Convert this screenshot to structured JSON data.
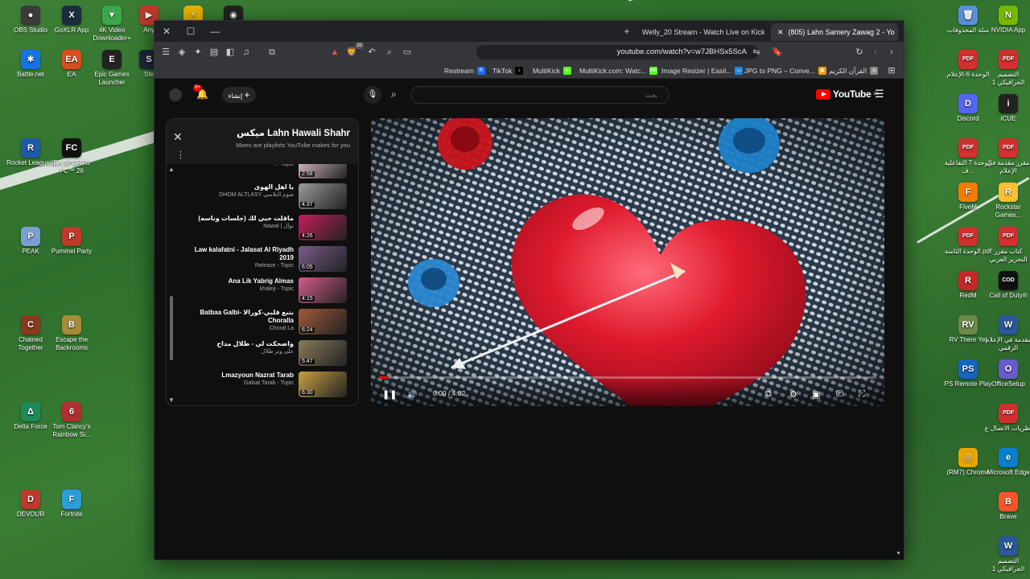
{
  "desktop": {
    "left_icons": [
      {
        "label": "OBS Studio",
        "color": "#3b3b3b",
        "glyph": "●"
      },
      {
        "label": "GoXLR App",
        "color": "#1c2c3a",
        "glyph": "X"
      },
      {
        "label": "4K Video Downloader+",
        "color": "#3aa84a",
        "glyph": "▼"
      },
      {
        "label": "Any",
        "color": "#c0392b",
        "glyph": "▶"
      },
      {
        "label": "",
        "color": "#e8b100",
        "glyph": "⚡"
      },
      {
        "label": "",
        "color": "#222222",
        "glyph": "◉"
      },
      {
        "label": "Battle.net",
        "color": "#1473e6",
        "glyph": "✱"
      },
      {
        "label": "EA",
        "color": "#d9501e",
        "glyph": "EA"
      },
      {
        "label": "Epic Games Launcher",
        "color": "#222222",
        "glyph": "E"
      },
      {
        "label": "Ste",
        "color": "#1b2838",
        "glyph": "S"
      },
      {
        "label": "Rocket League®",
        "color": "#1e5aa8",
        "glyph": "R"
      },
      {
        "label": "EA SPORTS FC™ 26",
        "color": "#111111",
        "glyph": "FC"
      },
      {
        "label": "PEAK",
        "color": "#7a9fd0",
        "glyph": "P"
      },
      {
        "label": "Pummel Party",
        "color": "#c0392b",
        "glyph": "P"
      },
      {
        "label": "Chained Together",
        "color": "#8b3a1f",
        "glyph": "C"
      },
      {
        "label": "Escape the Backrooms",
        "color": "#a88b3a",
        "glyph": "B"
      },
      {
        "label": "Delta Force",
        "color": "#1e8a5a",
        "glyph": "Δ"
      },
      {
        "label": "Tom Clancy's Rainbow Si...",
        "color": "#b03030",
        "glyph": "6"
      },
      {
        "label": "DEVOUR",
        "color": "#c0392b",
        "glyph": "D"
      },
      {
        "label": "Fortnite",
        "color": "#2a9fd6",
        "glyph": "F"
      }
    ],
    "right_icons": [
      {
        "label": "سلة المحذوفات",
        "color": "#5a8fd8",
        "glyph": "🗑"
      },
      {
        "label": "NVIDIA App",
        "color": "#76b900",
        "glyph": "N"
      },
      {
        "label": "الوحدة 6-الإعلام",
        "color": "#d32f2f",
        "glyph": "PDF"
      },
      {
        "label": "التصميم الجرافيكي 1",
        "color": "#d32f2f",
        "glyph": "PDF"
      },
      {
        "label": "Discord",
        "color": "#5865f2",
        "glyph": "D"
      },
      {
        "label": "iCUE",
        "color": "#222222",
        "glyph": "i"
      },
      {
        "label": "الوحدة 7 التفاعلية ف...",
        "color": "#d32f2f",
        "glyph": "PDF"
      },
      {
        "label": "مقرر مقدمة في الإعلام",
        "color": "#d32f2f",
        "glyph": "PDF"
      },
      {
        "label": "FiveM",
        "color": "#f57c00",
        "glyph": "F"
      },
      {
        "label": "Rockstar Games...",
        "color": "#fbc02d",
        "glyph": "R"
      },
      {
        "label": "الوحدة الثامنة.pdf",
        "color": "#d32f2f",
        "glyph": "PDF"
      },
      {
        "label": "كتاب مقرر التحرير العربي",
        "color": "#d32f2f",
        "glyph": "PDF"
      },
      {
        "label": "RedM",
        "color": "#c62828",
        "glyph": "R"
      },
      {
        "label": "Call of Duty®",
        "color": "#111111",
        "glyph": "COD"
      },
      {
        "label": "RV There Yet",
        "color": "#6d8a4a",
        "glyph": "RV"
      },
      {
        "label": "مقدمة في الإعلام الرقمي",
        "color": "#2b579a",
        "glyph": "W"
      },
      {
        "label": "PS Remote Play",
        "color": "#1565c0",
        "glyph": "PS"
      },
      {
        "label": "OfficeSetup",
        "color": "#6a5acd",
        "glyph": "O"
      },
      {
        "label": "نظريات الاتصال ع",
        "color": "#d32f2f",
        "glyph": "PDF"
      },
      {
        "label": "(RM7) Chrome",
        "color": "#e8a400",
        "glyph": "◎"
      },
      {
        "label": "Microsoft Edge",
        "color": "#0a7fd0",
        "glyph": "e"
      },
      {
        "label": "Brave",
        "color": "#fb542b",
        "glyph": "B"
      },
      {
        "label": "التصميم الجرافيكي 1",
        "color": "#2b579a",
        "glyph": "W"
      }
    ]
  },
  "browser": {
    "tabs": [
      {
        "label": "Welly_20 Stream - Watch Live on Kick",
        "badge_color": "#53fc18"
      },
      {
        "label": "(805) Lahn Samery Zawag 2 - Yo",
        "badge_color": "#ff0000"
      }
    ],
    "url": "youtube.com/watch?v=w7JBHSx5ScA",
    "brave_badge": "20",
    "bookmarks": [
      {
        "label": "Restream",
        "color": "#1e6bff",
        "glyph": "R"
      },
      {
        "label": "TikTok",
        "color": "#000000",
        "glyph": "♪"
      },
      {
        "label": "MultiKick",
        "color": "#53fc18",
        "glyph": "K"
      },
      {
        "label": "MultiKick.com: Watc...",
        "color": "#53fc18",
        "glyph": "MK"
      },
      {
        "label": "Image Resizer | Easil...",
        "color": "#1e88e5",
        "glyph": "▭"
      },
      {
        "label": "JPG to PNG – Conve...",
        "color": "#f39c12",
        "glyph": "▣"
      },
      {
        "label": "القرآن الكريم",
        "color": "#888888",
        "glyph": "◎"
      }
    ]
  },
  "youtube": {
    "create_label": "إنشاء",
    "notif_count": "9+",
    "search_placeholder": "بحث",
    "logo_text": "YouTube",
    "logo_region": "SA",
    "playlist": {
      "title": "ميكس Lahn Hawali Shahr",
      "subtitle": "Mixes are playlists YouTube makes for you",
      "items": [
        {
          "title": "",
          "channel": "... Topic",
          "duration": "2:58",
          "thumb": "#e8c8d0"
        },
        {
          "title": "يا اهل الهوى",
          "channel": "DHOM ALTLASY ضوم التلاسي",
          "duration": "4:37",
          "thumb": "#9a9a9a"
        },
        {
          "title": "ماقلت حبي لك (جلسات وناسه)",
          "channel": "Nawal | نوال",
          "duration": "4:26",
          "thumb": "#c41e5a"
        },
        {
          "title": "Law kalafatni - Jalasat Al Riyadh 2019",
          "channel": "Release - Topic",
          "duration": "6:05",
          "thumb": "#7b5a8a"
        },
        {
          "title": "Ana Lik Yabrig Almas",
          "channel": "khaleji - Topic",
          "duration": "4:15",
          "thumb": "#d65a8a"
        },
        {
          "title": "Batbaa Galbi- بتبع قلبي-كورالا Choralla",
          "channel": "Choral La",
          "duration": "6:24",
          "thumb": "#a05a3a"
        },
        {
          "title": "واضحكت لي - طلال مداح",
          "channel": "على وتر طلال",
          "duration": "5:47",
          "thumb": "#8a7a5a"
        },
        {
          "title": "Lmazyoun Nazrat Tarab",
          "channel": "Galsat Tarab - Topic",
          "duration": "6:30",
          "thumb": "#c8a040"
        }
      ]
    },
    "player": {
      "time_current": "0:00",
      "time_total": "4:02",
      "progress": 0.02
    }
  }
}
